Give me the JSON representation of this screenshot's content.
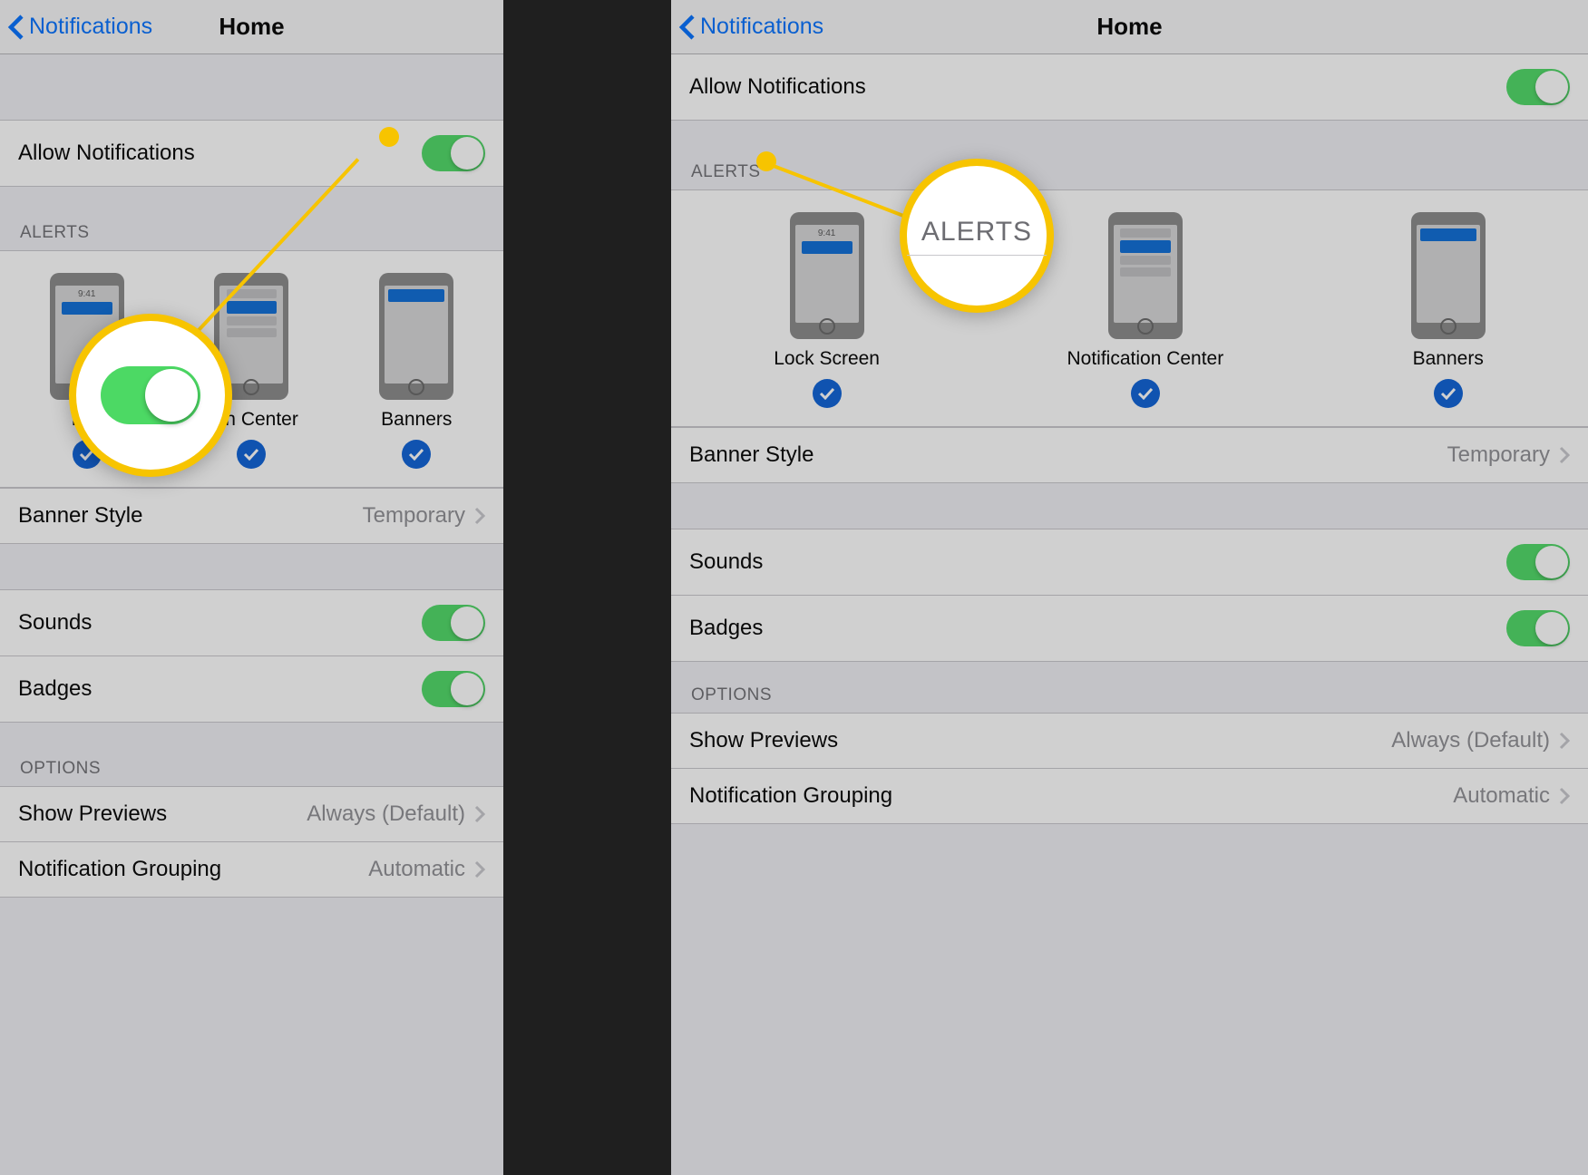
{
  "nav": {
    "back_label": "Notifications",
    "title": "Home"
  },
  "rows": {
    "allow": "Allow Notifications",
    "banner_style_label": "Banner Style",
    "banner_style_value": "Temporary",
    "sounds": "Sounds",
    "badges": "Badges",
    "show_previews_label": "Show Previews",
    "show_previews_value": "Always (Default)",
    "grouping_label": "Notification Grouping",
    "grouping_value": "Automatic"
  },
  "headers": {
    "alerts": "ALERTS",
    "options": "OPTIONS"
  },
  "alerts": {
    "lock_left": "Loc",
    "lock": "Lock Screen",
    "center_left": "tion Center",
    "center": "Notification Center",
    "banners": "Banners",
    "time": "9:41"
  },
  "callouts": {
    "alerts_text": "ALERTS"
  },
  "colors": {
    "accent_blue": "#006fff",
    "toggle_green": "#4cd964",
    "check_blue": "#0a5fd6",
    "highlight": "#f7c400"
  }
}
